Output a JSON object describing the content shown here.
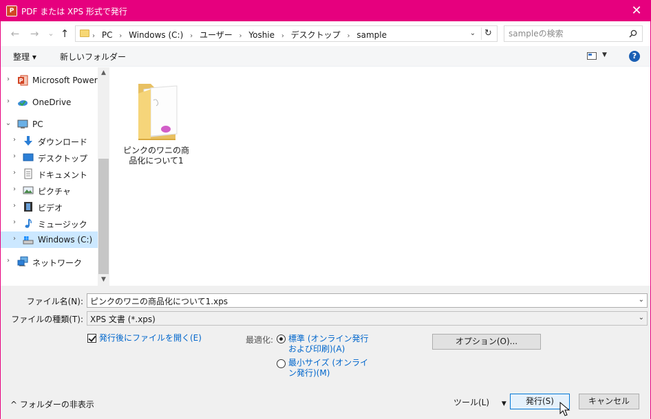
{
  "titlebar": {
    "app_icon_text": "P",
    "title": "PDF または XPS 形式で発行",
    "close": "✕"
  },
  "nav": {
    "back": "←",
    "forward": "→",
    "recent": "⌄",
    "up": "↑",
    "breadcrumbs": [
      "PC",
      "Windows (C:)",
      "ユーザー",
      "Yoshie",
      "デスクトップ",
      "sample"
    ],
    "crumb_sep": "›",
    "addr_drop": "⌄",
    "refresh": "↻",
    "search_placeholder": "sampleの検索"
  },
  "toolbar": {
    "organize": "整理 ▾",
    "new_folder": "新しいフォルダー",
    "view_drop": "▼",
    "help": "?"
  },
  "tree": [
    {
      "label": "Microsoft PowerP",
      "chev": "›",
      "icon": "powerpoint-icon"
    },
    {
      "label": "OneDrive",
      "chev": "›",
      "icon": "onedrive-icon"
    },
    {
      "label": "PC",
      "chev": "⌄",
      "icon": "pc-icon"
    },
    {
      "label": "ダウンロード",
      "chev": "›",
      "icon": "download-icon"
    },
    {
      "label": "デスクトップ",
      "chev": "›",
      "icon": "desktop-icon"
    },
    {
      "label": "ドキュメント",
      "chev": "›",
      "icon": "documents-icon"
    },
    {
      "label": "ピクチャ",
      "chev": "›",
      "icon": "pictures-icon"
    },
    {
      "label": "ビデオ",
      "chev": "›",
      "icon": "video-icon"
    },
    {
      "label": "ミュージック",
      "chev": "›",
      "icon": "music-icon"
    },
    {
      "label": "Windows (C:)",
      "chev": "›",
      "icon": "drive-icon"
    },
    {
      "label": "ネットワーク",
      "chev": "›",
      "icon": "network-icon"
    }
  ],
  "scroll": {
    "up": "▲",
    "down": "▼"
  },
  "files": [
    {
      "name": "ピンクのワニの商品化について1",
      "icon": "folder-icon"
    }
  ],
  "form": {
    "filename_label": "ファイル名(N):",
    "filename_value": "ピンクのワニの商品化について1.xps",
    "filetype_label": "ファイルの種類(T):",
    "filetype_value": "XPS 文書 (*.xps)",
    "drop": "⌄",
    "open_after_label": "発行後にファイルを開く(E)",
    "optimize_label": "最適化:",
    "radio_standard": "標準 (オンライン発行および印刷)(A)",
    "radio_minimum": "最小サイズ (オンライン発行)(M)",
    "options_button": "オプション(O)..."
  },
  "footer": {
    "collapse": "^  フォルダーの非表示",
    "tools": "ツール(L)",
    "tools_drop": "▼",
    "publish": "発行(S)",
    "cancel": "キャンセル"
  }
}
